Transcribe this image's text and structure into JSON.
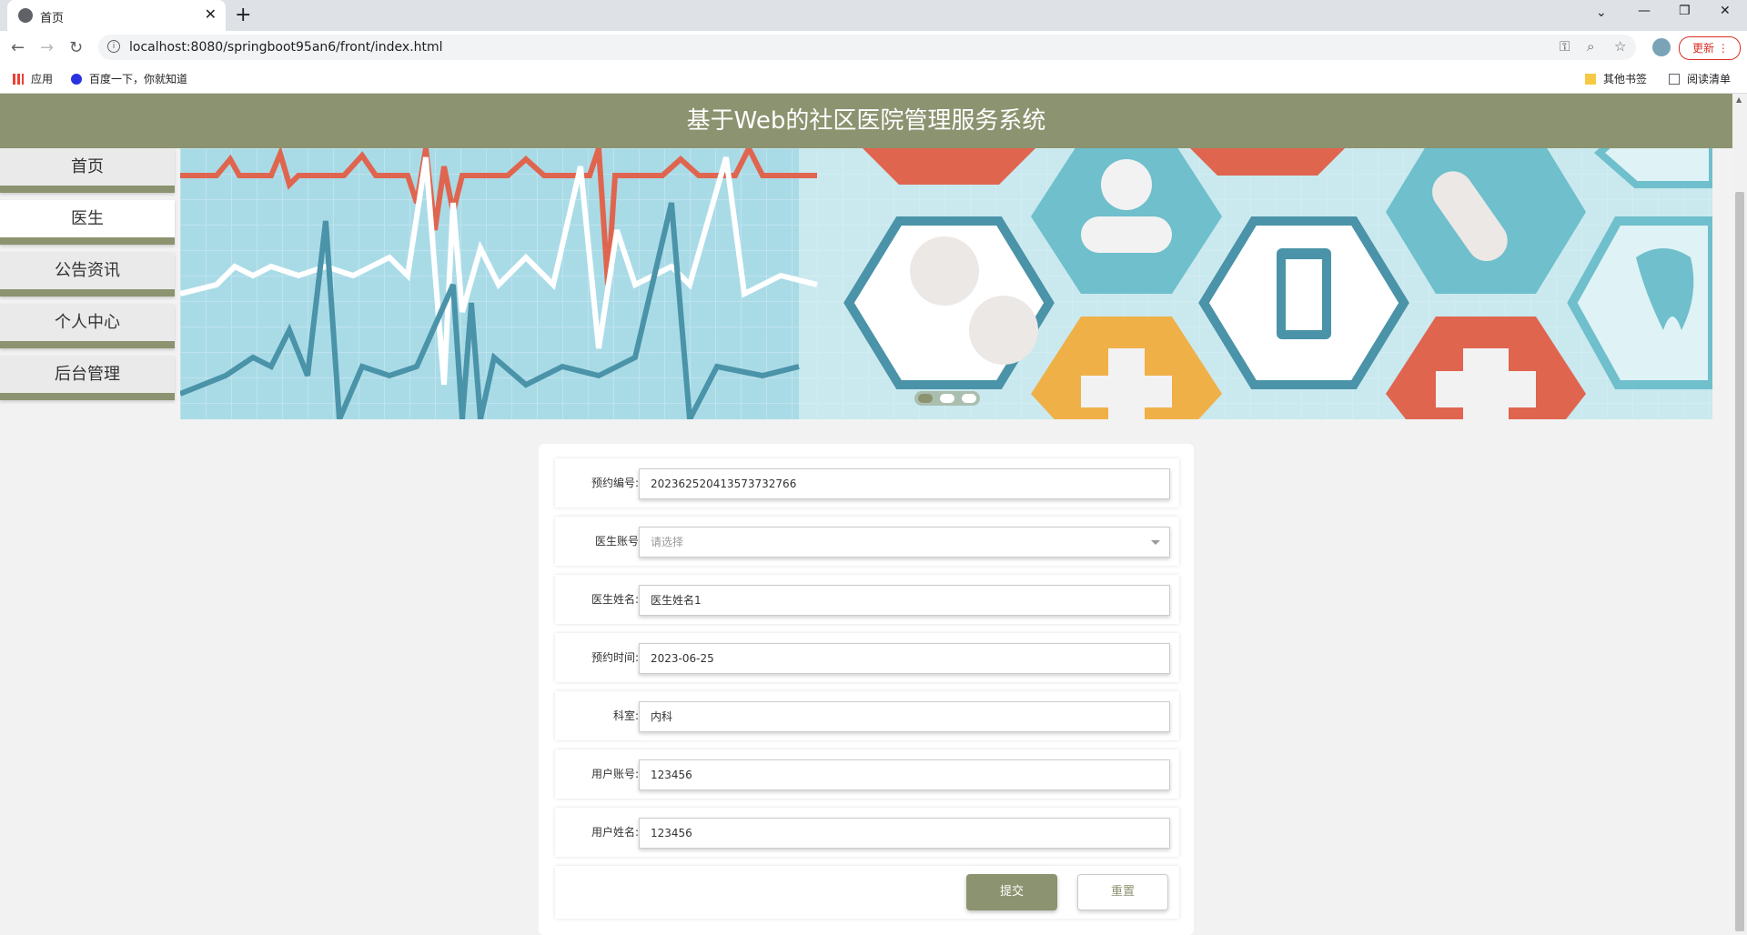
{
  "browser": {
    "tab_title": "首页",
    "url": "localhost:8080/springboot95an6/front/index.html",
    "update_label": "更新",
    "bookmarks": {
      "apps": "应用",
      "baidu": "百度一下，你就知道",
      "other": "其他书签",
      "reading": "阅读清单"
    }
  },
  "page": {
    "title": "基于Web的社区医院管理服务系统"
  },
  "sidebar": {
    "items": [
      {
        "label": "首页"
      },
      {
        "label": "医生"
      },
      {
        "label": "公告资讯"
      },
      {
        "label": "个人中心"
      },
      {
        "label": "后台管理"
      }
    ],
    "active_index": 1
  },
  "form": {
    "fields": [
      {
        "label": "预约编号:",
        "value": "20236252041357373276​6"
      },
      {
        "label": "医生账号",
        "placeholder": "请选择"
      },
      {
        "label": "医生姓名:",
        "value": "医生姓名1"
      },
      {
        "label": "预约时间:",
        "value": "2023-06-25"
      },
      {
        "label": "科室:",
        "value": "内科"
      },
      {
        "label": "用户账号:",
        "value": "123456"
      },
      {
        "label": "用户姓名:",
        "value": "123456"
      }
    ],
    "submit_label": "提交",
    "reset_label": "重置"
  },
  "colors": {
    "accent": "#8c9370",
    "banner_blue": "#6fbfcc",
    "banner_red": "#e0654f",
    "banner_orange": "#f0b048"
  }
}
